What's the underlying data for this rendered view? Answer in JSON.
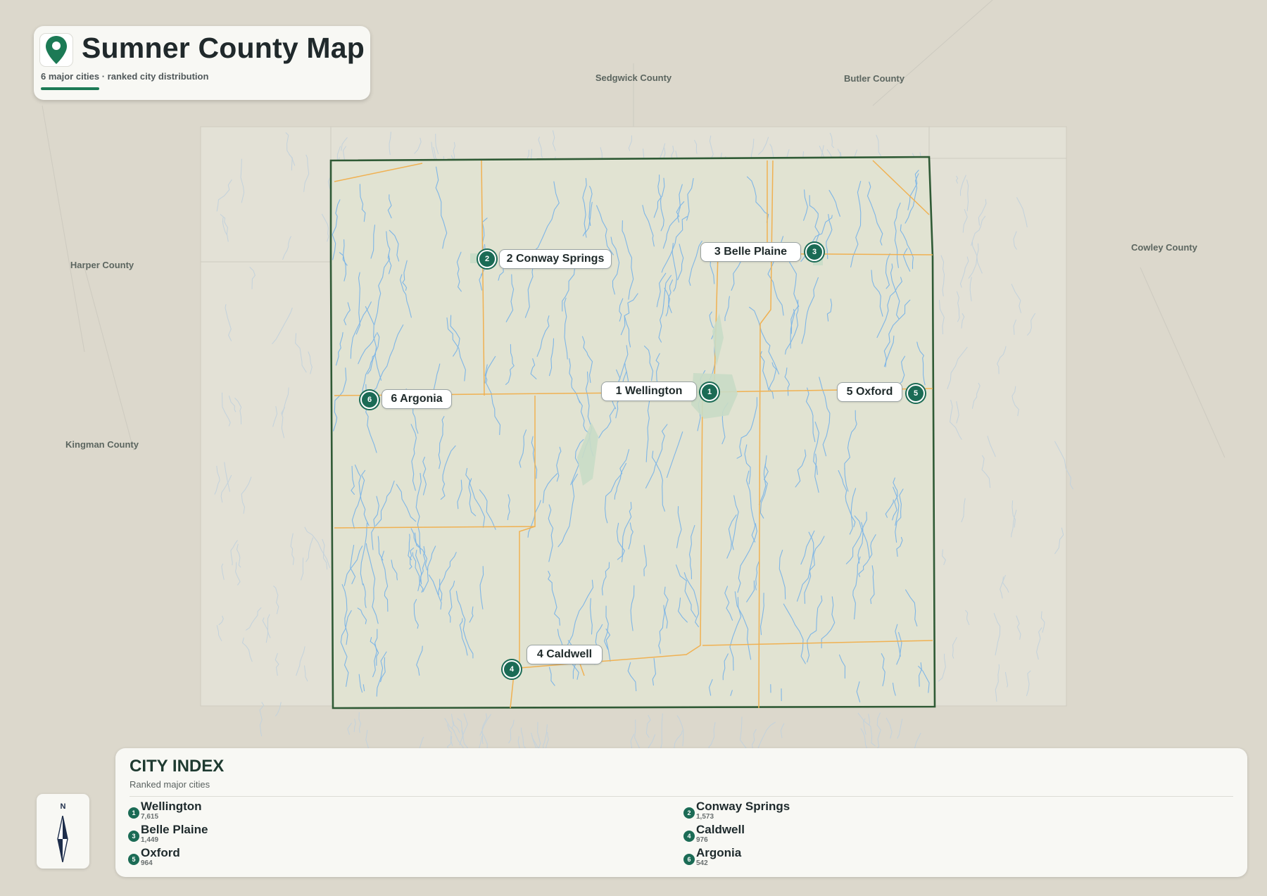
{
  "title_card": {
    "title": "Sumner County Map",
    "subtitle": "6 major cities · ranked city distribution",
    "icon": "map-pin-icon"
  },
  "neighbor_counties": [
    "Sedgwick County",
    "Butler County",
    "Cowley County",
    "Harper County",
    "Kingman County"
  ],
  "cities": [
    {
      "rank": "1",
      "name": "Wellington",
      "callout": "1 Wellington",
      "population": "7,615"
    },
    {
      "rank": "2",
      "name": "Conway Springs",
      "callout": "2 Conway Springs",
      "population": "1,573"
    },
    {
      "rank": "3",
      "name": "Belle Plaine",
      "callout": "3 Belle Plaine",
      "population": "1,449"
    },
    {
      "rank": "4",
      "name": "Caldwell",
      "callout": "4 Caldwell",
      "population": "976"
    },
    {
      "rank": "5",
      "name": "Oxford",
      "callout": "5 Oxford",
      "population": "964"
    },
    {
      "rank": "6",
      "name": "Argonia",
      "callout": "6 Argonia",
      "population": "542"
    }
  ],
  "compass": {
    "label": "N",
    "icon": "compass-arrow-icon"
  },
  "city_index": {
    "title": "CITY INDEX",
    "subtitle": "Ranked major cities"
  },
  "colors": {
    "county_border": "#2f5a35",
    "county_fill": "#e1e3d2",
    "roads": "#f0b152",
    "rivers": "#7fb6e6",
    "marker": "#1b6b55",
    "accent": "#1c7a55"
  }
}
